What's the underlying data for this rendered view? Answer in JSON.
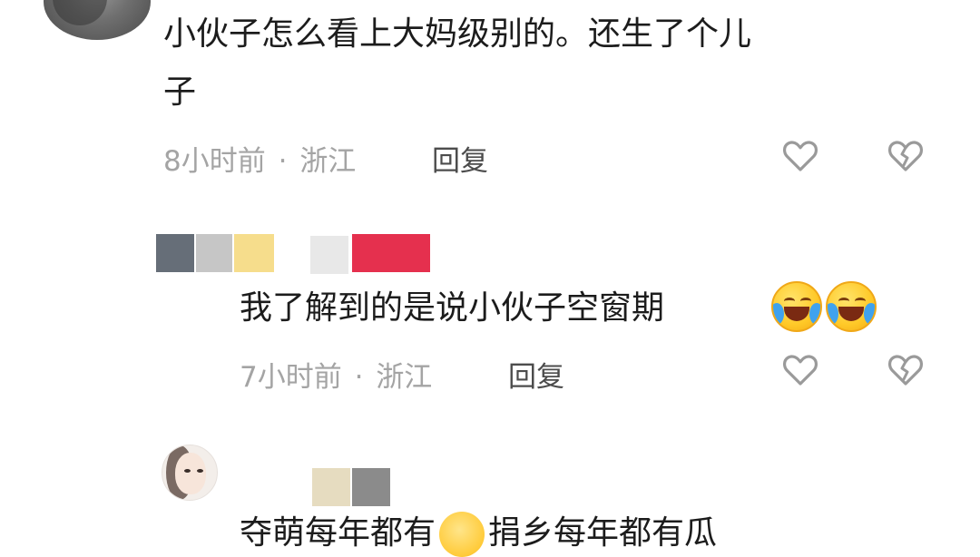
{
  "comments": [
    {
      "text_line1": "小伙子怎么看上大妈级别的。还生了个儿",
      "text_line2": "子",
      "time": "8小时前",
      "separator": "·",
      "location": "浙江",
      "reply_label": "回复"
    },
    {
      "text": "我了解到的是说小伙子空窗期",
      "emojis": [
        "laughing-crying-emoji",
        "laughing-crying-emoji"
      ],
      "time": "7小时前",
      "separator": "·",
      "location": "浙江",
      "reply_label": "回复",
      "redacted_username_colors": [
        "#666e78",
        "#c6c6c6",
        "#f6dd8c",
        "#dcdcdc",
        "#e5304e"
      ]
    },
    {
      "text_part1": "夺萌每年都有",
      "text_part2": "捐乡每年都有瓜",
      "redacted_username_colors": [
        "#e6dcc0",
        "#8b8b8b"
      ]
    }
  ],
  "icons": {
    "like": "heart-outline-icon",
    "dislike": "broken-heart-icon"
  },
  "colors": {
    "meta_text": "#a4a4a4",
    "reply_text": "#4c4c4c",
    "body_text": "#1c1c1c"
  }
}
